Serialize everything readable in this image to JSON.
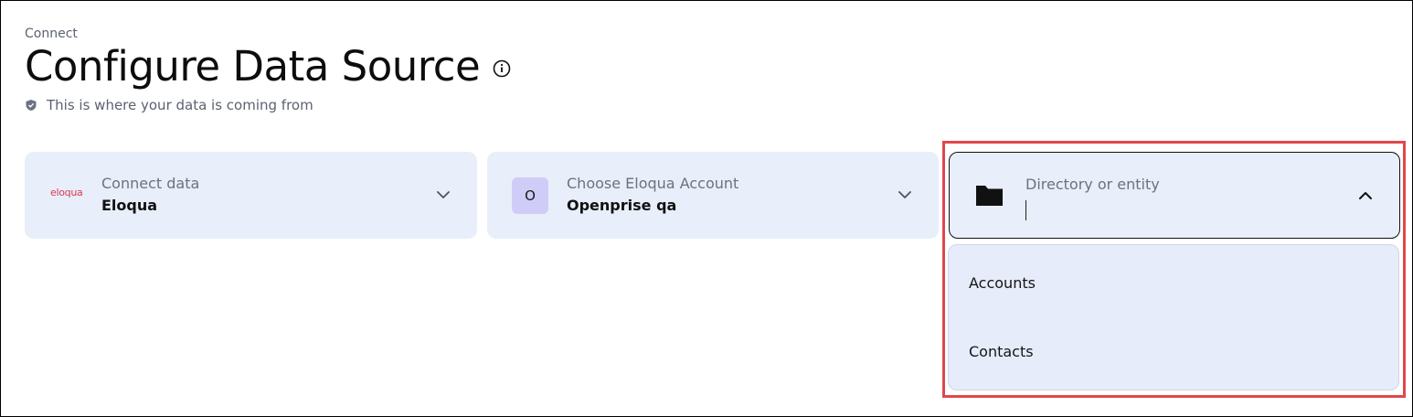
{
  "header": {
    "breadcrumb": "Connect",
    "title": "Configure Data Source",
    "subtitle": "This is where your data is coming from"
  },
  "icons": {
    "info": "info-icon",
    "shield": "shield-check-icon",
    "chevron_down": "chevron-down-icon",
    "chevron_up": "chevron-up-icon",
    "folder": "folder-icon"
  },
  "cards": [
    {
      "label": "Connect data",
      "value": "Eloqua",
      "logo_text": "eloqua"
    },
    {
      "label": "Choose Eloqua Account",
      "value": "Openprise qa",
      "avatar": "O"
    },
    {
      "label": "Directory or entity",
      "value": ""
    }
  ],
  "dropdown": {
    "options": [
      "Accounts",
      "Contacts"
    ]
  },
  "colors": {
    "card_bg": "#e8eefa",
    "highlight": "#e0474c",
    "avatar_bg": "#cfcdf7",
    "logo": "#d83b4f"
  }
}
